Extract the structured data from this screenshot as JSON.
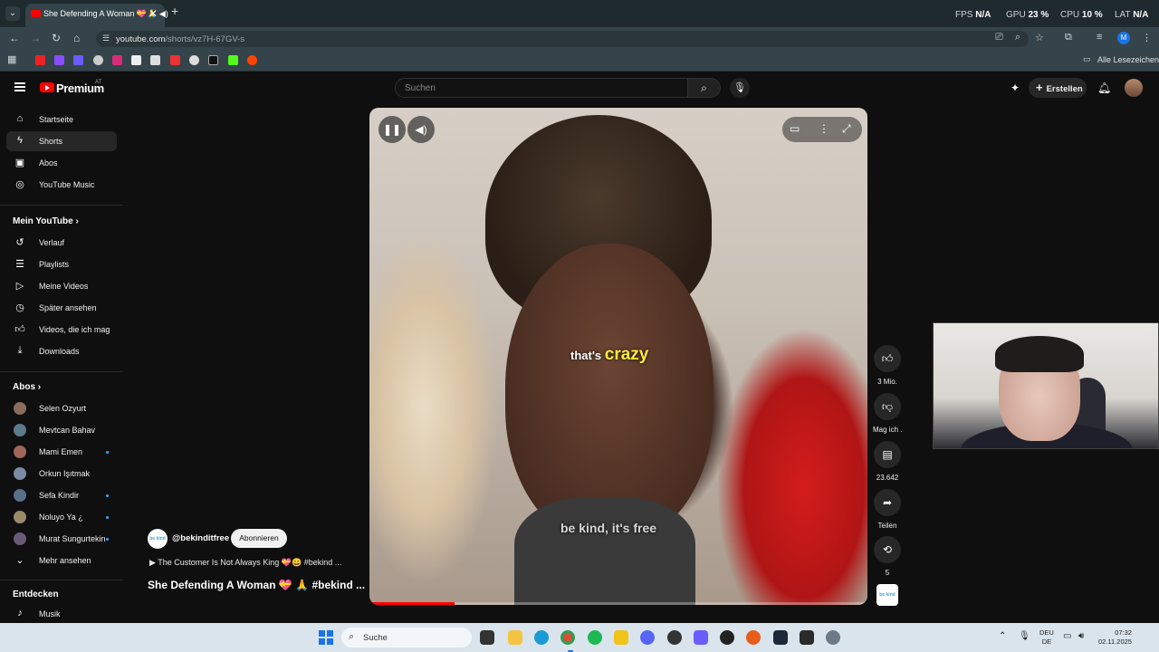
{
  "browser": {
    "tab_title": "She Defending A Woman 💝🙏 ◀)",
    "tab_close": "✕",
    "new_tab": "+",
    "url_domain": "youtube.com",
    "url_path": "/shorts/vz7H-67GV-s",
    "profile_initial": "M",
    "bookmarks_all": "Alle Lesezeichen",
    "perf": {
      "fps_label": "FPS",
      "fps_value": "N/A",
      "gpu_label": "GPU",
      "gpu_value": "23 %",
      "cpu_label": "CPU",
      "cpu_value": "10 %",
      "lat_label": "LAT",
      "lat_value": "N/A"
    }
  },
  "header": {
    "brand": "Premium",
    "region": "AT",
    "search_placeholder": "Suchen",
    "create_label": "Erstellen"
  },
  "sidebar": {
    "main": [
      {
        "label": "Startseite",
        "icon": "home-icon"
      },
      {
        "label": "Shorts",
        "icon": "shorts-icon",
        "active": true
      },
      {
        "label": "Abos",
        "icon": "subscriptions-icon"
      },
      {
        "label": "YouTube Music",
        "icon": "music-icon"
      }
    ],
    "you_heading": "Mein YouTube",
    "you": [
      {
        "label": "Verlauf",
        "icon": "history-icon"
      },
      {
        "label": "Playlists",
        "icon": "playlists-icon"
      },
      {
        "label": "Meine Videos",
        "icon": "my-videos-icon"
      },
      {
        "label": "Später ansehen",
        "icon": "watch-later-icon"
      },
      {
        "label": "Videos, die ich mag",
        "icon": "liked-icon"
      },
      {
        "label": "Downloads",
        "icon": "download-icon"
      }
    ],
    "subs_heading": "Abos",
    "subs": [
      {
        "label": "Selen Ozyurt",
        "color": "#8a6d5c",
        "dot": false
      },
      {
        "label": "Mevtcan Bahav",
        "color": "#5d7a8c",
        "dot": false
      },
      {
        "label": "Mami Emen",
        "color": "#a0665a",
        "dot": true
      },
      {
        "label": "Orkun Işıtmak",
        "color": "#7a8aa0",
        "dot": false
      },
      {
        "label": "Sefa Kindir",
        "color": "#5a6f8a",
        "dot": true
      },
      {
        "label": "Noluyo Ya ¿",
        "color": "#9a8a6a",
        "dot": true
      },
      {
        "label": "Murat Sungurtekin",
        "color": "#6a5a7a",
        "dot": true
      }
    ],
    "more_label": "Mehr ansehen",
    "explore_heading": "Entdecken",
    "explore": [
      {
        "label": "Musik",
        "icon": "music-note-icon"
      }
    ]
  },
  "video": {
    "caption_prefix": "that's",
    "caption_highlight": "crazy",
    "caption_bottom": "be kind, it's free",
    "progress": 0.17
  },
  "actions": {
    "likes": "3 Mio.",
    "dislike": "Mag ich .",
    "comments": "23.642",
    "share": "Teilen",
    "remix": "5",
    "channel_thumb": "be kind"
  },
  "channel": {
    "handle": "@bekinditfree",
    "avatar_text": "be kind",
    "subscribe": "Abonnieren",
    "playlist": "The Customer Is Not Always King 💝😄 #bekind ...",
    "title": "She Defending A Woman 💝 🙏 #bekind ..."
  },
  "taskbar": {
    "search": "Suche",
    "lang_top": "DEU",
    "lang_bottom": "DE",
    "time": "07:32",
    "date": "02.11.2025"
  }
}
